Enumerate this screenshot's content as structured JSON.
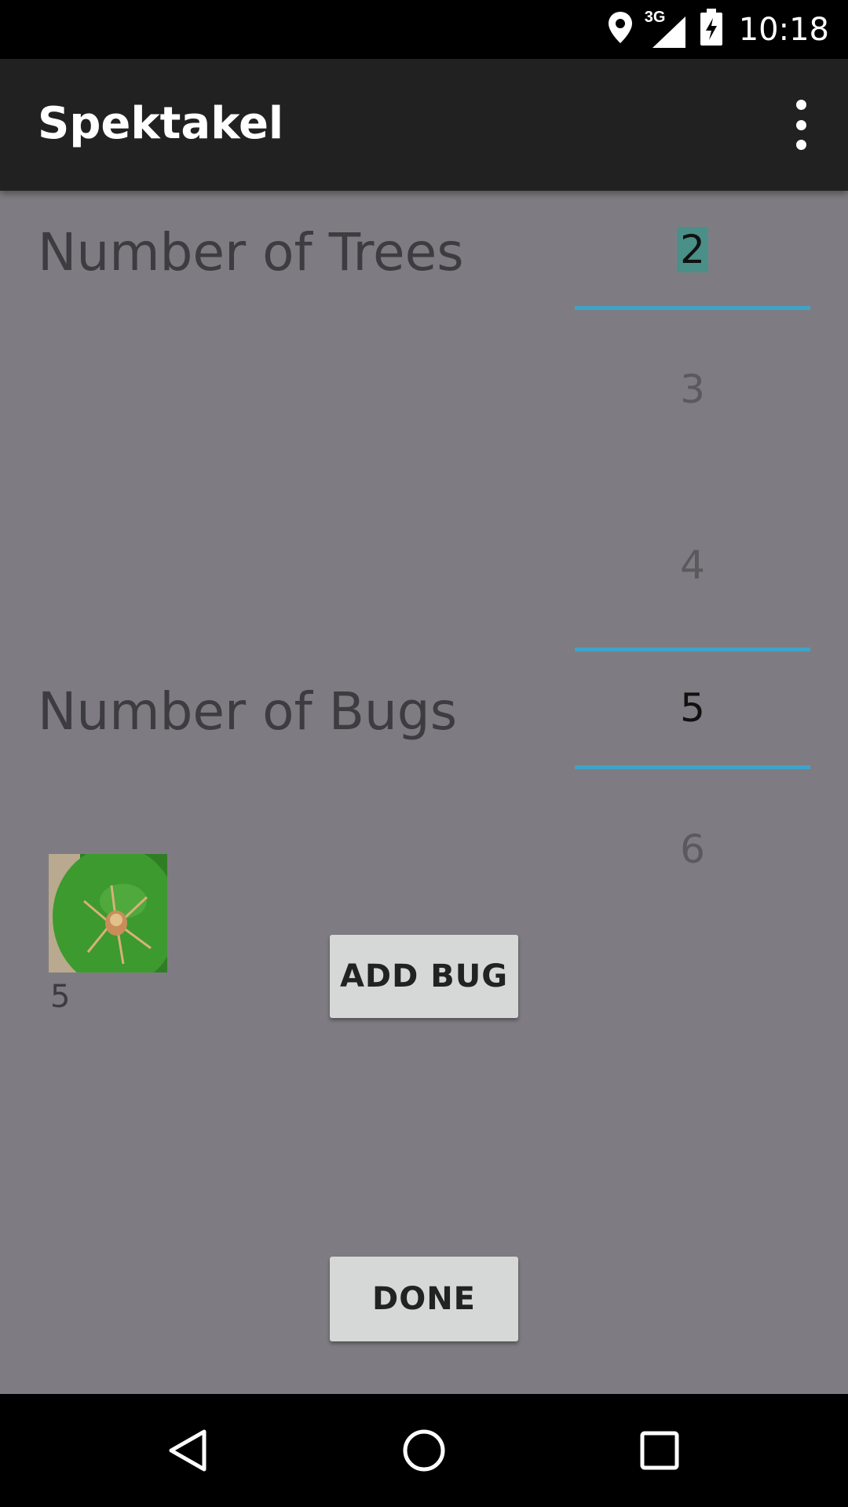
{
  "status_bar": {
    "network": "3G",
    "time": "10:18",
    "icons": [
      "location-icon",
      "signal-icon",
      "battery-charging-icon"
    ]
  },
  "app_bar": {
    "title": "Spektakel",
    "menu_icon": "overflow-menu-icon"
  },
  "trees": {
    "label": "Number of Trees",
    "selected": "2",
    "below": [
      "3",
      "4"
    ]
  },
  "bugs": {
    "label": "Number of Bugs",
    "selected": "5",
    "below": "6"
  },
  "buttons": {
    "add_bug": "ADD BUG",
    "done": "DONE"
  },
  "bug_list": [
    {
      "thumbnail": "bug-photo",
      "count": "5"
    }
  ],
  "colors": {
    "background": "#7e7c82",
    "app_bar": "#212121",
    "accent_line": "#3ea4c9",
    "selection_highlight": "#4a8f88",
    "button": "#d6d7d7"
  },
  "nav_bar": {
    "buttons": [
      "back-icon",
      "home-icon",
      "recents-icon"
    ]
  }
}
